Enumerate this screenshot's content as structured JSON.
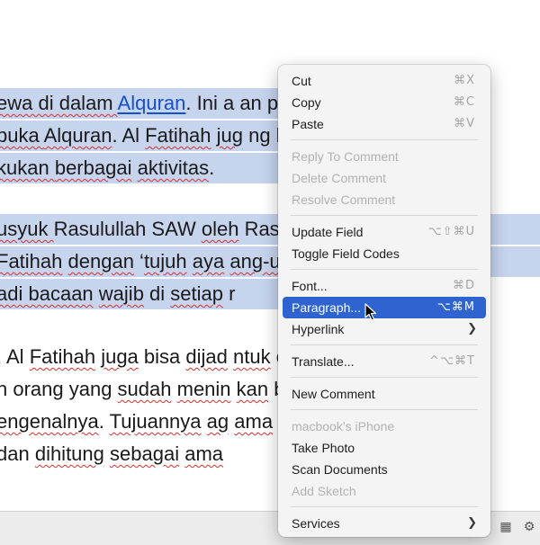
{
  "document": {
    "lines": [
      {
        "segments": [
          {
            "t": "ewa di dalam ",
            "sq": true
          },
          {
            "t": "Alquran",
            "link": true
          },
          {
            "t": ". Ini a"
          },
          {
            "t": "        ",
            "gap": true
          },
          {
            "t": "an pe"
          }
        ]
      },
      {
        "segments": [
          {
            "t": "buka ",
            "sq": true
          },
          {
            "t": "Alquran",
            "sq": true
          },
          {
            "t": ". Al "
          },
          {
            "t": "Fatihah",
            "sq": true
          },
          {
            "t": " "
          },
          {
            "t": "jug",
            "sq": true
          },
          {
            "t": "        ",
            "gap": true
          },
          {
            "t": "ng ke"
          }
        ]
      },
      {
        "segments": [
          {
            "t": "kukan ",
            "sq": true
          },
          {
            "t": "berbagai",
            "sq": true
          },
          {
            "t": " "
          },
          {
            "t": "aktivitas",
            "sq": true
          },
          {
            "t": "."
          }
        ]
      },
      {
        "segments": [
          {
            "t": "usyuk ",
            "sq": true
          },
          {
            "t": "Rasulullah SAW "
          },
          {
            "t": "oleh",
            "sq": true
          },
          {
            "t": "        ",
            "gap": true
          },
          {
            "t": "Rasul"
          }
        ]
      },
      {
        "segments": [
          {
            "t": " "
          },
          {
            "t": "Fatihah",
            "sq": true
          },
          {
            "t": " "
          },
          {
            "t": "dengan",
            "sq": true
          },
          {
            "t": " ‘"
          },
          {
            "t": "tujuh",
            "sq": true
          },
          {
            "t": " "
          },
          {
            "t": "aya",
            "sq": true
          },
          {
            "t": "        ",
            "gap": true
          },
          {
            "t": "ang-u",
            "sq": true
          }
        ]
      },
      {
        "segments": [
          {
            "t": "adi ",
            "sq": true
          },
          {
            "t": "bacaan",
            "sq": true
          },
          {
            "t": " "
          },
          {
            "t": "wajib",
            "sq": true
          },
          {
            "t": " di "
          },
          {
            "t": "setiap",
            "sq": true
          },
          {
            "t": " r"
          }
        ]
      },
      {
        "segments": [
          {
            "t": ", Al "
          },
          {
            "t": "Fatihah",
            "sq": true
          },
          {
            "t": " "
          },
          {
            "t": "juga",
            "sq": true
          },
          {
            "t": " bisa "
          },
          {
            "t": "dijad",
            "sq": true
          },
          {
            "t": "        ",
            "gap": true
          },
          {
            "t": "ntuk",
            "sq": true
          },
          {
            "t": " c"
          }
        ]
      },
      {
        "segments": [
          {
            "t": "h orang yang "
          },
          {
            "t": "sudah",
            "sq": true
          },
          {
            "t": " "
          },
          {
            "t": "menin",
            "sq": true
          },
          {
            "t": "        ",
            "gap": true
          },
          {
            "t": "kan",
            "sq": true
          },
          {
            "t": " b"
          }
        ]
      },
      {
        "segments": [
          {
            "t": "engenalnya",
            "sq": true
          },
          {
            "t": ". "
          },
          {
            "t": "Tujuannya",
            "sq": true
          },
          {
            "t": " "
          },
          {
            "t": "ag",
            "sq": true
          },
          {
            "t": "        ",
            "gap": true
          },
          {
            "t": "ama",
            "sq": true
          },
          {
            "t": " i"
          }
        ]
      },
      {
        "segments": [
          {
            "t": " dan "
          },
          {
            "t": "dihitung",
            "sq": true
          },
          {
            "t": " "
          },
          {
            "t": "sebagai",
            "sq": true
          },
          {
            "t": " "
          },
          {
            "t": "ama",
            "sq": true
          }
        ]
      }
    ]
  },
  "context_menu": {
    "groups": [
      [
        {
          "label": "Cut",
          "shortcut": "⌘X",
          "disabled": false
        },
        {
          "label": "Copy",
          "shortcut": "⌘C",
          "disabled": false
        },
        {
          "label": "Paste",
          "shortcut": "⌘V",
          "disabled": false
        }
      ],
      [
        {
          "label": "Reply To Comment",
          "shortcut": "",
          "disabled": true
        },
        {
          "label": "Delete Comment",
          "shortcut": "",
          "disabled": true
        },
        {
          "label": "Resolve Comment",
          "shortcut": "",
          "disabled": true
        }
      ],
      [
        {
          "label": "Update Field",
          "shortcut": "⌥⇧⌘U",
          "disabled": false
        },
        {
          "label": "Toggle Field Codes",
          "shortcut": "",
          "disabled": false
        }
      ],
      [
        {
          "label": "Font...",
          "shortcut": "⌘D",
          "disabled": false
        },
        {
          "label": "Paragraph...",
          "shortcut": "⌥⌘M",
          "disabled": false,
          "highlighted": true
        },
        {
          "label": "Hyperlink",
          "shortcut": "",
          "disabled": false,
          "submenu": true
        }
      ],
      [
        {
          "label": "Translate...",
          "shortcut": "^⌥⌘T",
          "disabled": false
        }
      ],
      [
        {
          "label": "New Comment",
          "shortcut": "",
          "disabled": false
        }
      ],
      [
        {
          "label": "macbook’s iPhone",
          "shortcut": "",
          "disabled": true
        },
        {
          "label": "Take Photo",
          "shortcut": "",
          "disabled": false
        },
        {
          "label": "Scan Documents",
          "shortcut": "",
          "disabled": false
        },
        {
          "label": "Add Sketch",
          "shortcut": "",
          "disabled": true
        }
      ],
      [
        {
          "label": "Services",
          "shortcut": "",
          "disabled": false,
          "submenu": true
        }
      ]
    ]
  },
  "colors": {
    "selection": "#c6d4ee",
    "highlight": "#2f63d0",
    "link": "#1450c8",
    "spell_underline": "#d9302c"
  },
  "icons": {
    "submenu": "chevron-right-icon",
    "cursor": "mouse-pointer-icon"
  }
}
